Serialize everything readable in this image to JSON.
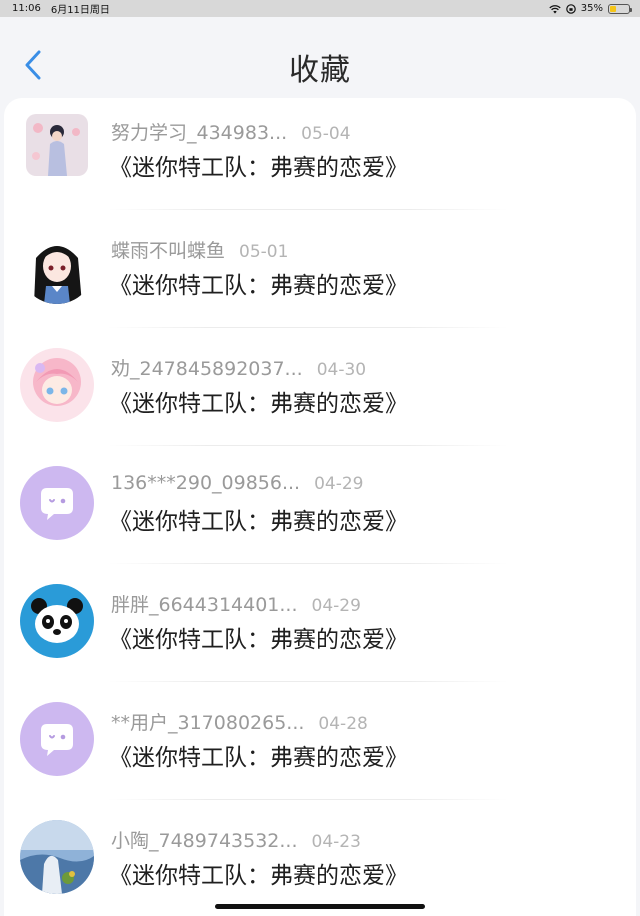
{
  "status_bar": {
    "time": "11:06",
    "date": "6月11日周日",
    "battery": "35%",
    "battery_level": 0.35
  },
  "nav": {
    "title": "收藏",
    "back_icon": "chevron-left-icon"
  },
  "accent_color": "#3a8ee6",
  "favorites": [
    {
      "username": "努力学习_434983...",
      "date": "05-04",
      "title": "《迷你特工队：弗赛的恋爱》",
      "avatar": "girl-photo"
    },
    {
      "username": "蝶雨不叫蝶鱼",
      "date": "05-01",
      "title": "《迷你特工队：弗赛的恋爱》",
      "avatar": "anime-girl-black-hair"
    },
    {
      "username": "劝_247845892037...",
      "date": "04-30",
      "title": "《迷你特工队：弗赛的恋爱》",
      "avatar": "anime-girl-pink-hair"
    },
    {
      "username": "136***290_09856...",
      "date": "04-29",
      "title": "《迷你特工队：弗赛的恋爱》",
      "avatar": "default-chat-bubble"
    },
    {
      "username": "胖胖_6644314401...",
      "date": "04-29",
      "title": "《迷你特工队：弗赛的恋爱》",
      "avatar": "pixel-panda"
    },
    {
      "username": "**用户_317080265...",
      "date": "04-28",
      "title": "《迷你特工队：弗赛的恋爱》",
      "avatar": "default-chat-bubble"
    },
    {
      "username": "小陶_7489743532...",
      "date": "04-23",
      "title": "《迷你特工队：弗赛的恋爱》",
      "avatar": "landscape-photo"
    }
  ]
}
